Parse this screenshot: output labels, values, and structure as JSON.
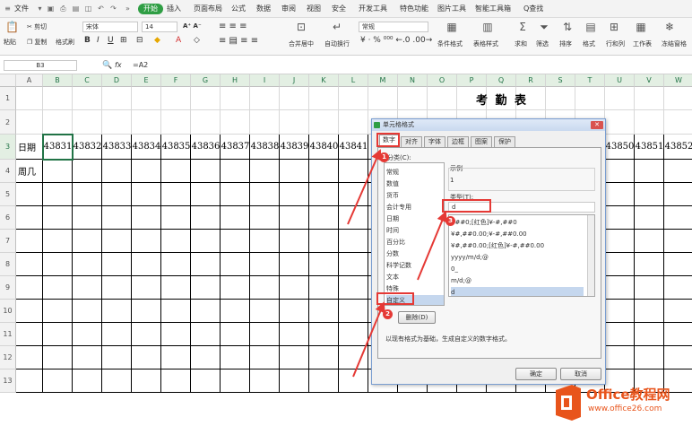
{
  "menu": {
    "file": "文件",
    "tabs": [
      "开始",
      "插入",
      "页面布局",
      "公式",
      "数据",
      "审阅",
      "视图",
      "安全",
      "开发工具",
      "特色功能",
      "图片工具",
      "智能工具箱"
    ],
    "search": "Q查找"
  },
  "ribbon": {
    "paste": "粘贴",
    "cut": "剪切",
    "copy": "复制",
    "format_painter": "格式刷",
    "font_name": "宋体",
    "font_size": "14",
    "merge_center": "合并居中",
    "wrap_text": "自动换行",
    "number_format": "常规",
    "conditional_format": "条件格式",
    "table_style": "表格样式",
    "sum": "求和",
    "filter": "筛选",
    "sort": "排序",
    "format": "格式",
    "rows_cols": "行和列",
    "worksheet": "工作表",
    "freeze": "冻结窗格"
  },
  "formula_bar": {
    "name_box": "B3",
    "fx": "fx",
    "formula": "=A2"
  },
  "columns": [
    "A",
    "B",
    "C",
    "D",
    "E",
    "F",
    "G",
    "H",
    "I",
    "J",
    "K",
    "L",
    "M",
    "N",
    "O",
    "P",
    "Q",
    "R",
    "S",
    "T",
    "U",
    "V",
    "W"
  ],
  "rows": [
    "1",
    "2",
    "3",
    "4",
    "5",
    "6",
    "7",
    "8",
    "9",
    "10",
    "11",
    "12",
    "13"
  ],
  "sheet": {
    "title": "考  勤  表",
    "row3_label": "日期",
    "row4_label": "周几",
    "dates_left": [
      "43831",
      "43832",
      "43833",
      "43834",
      "43835",
      "43836",
      "43837",
      "43838",
      "43839",
      "43840",
      "43841"
    ],
    "dates_right": [
      "43850",
      "43851",
      "43852"
    ]
  },
  "dialog": {
    "title": "单元格格式",
    "tabs": [
      "数字",
      "对齐",
      "字体",
      "边框",
      "图案",
      "保护"
    ],
    "category_label": "分类(C):",
    "categories": [
      "常规",
      "数值",
      "货币",
      "会计专用",
      "日期",
      "时间",
      "百分比",
      "分数",
      "科学记数",
      "文本",
      "特殊",
      "自定义"
    ],
    "sample_label": "示例",
    "sample_value": "1",
    "type_label": "类型(T):",
    "type_value": "d",
    "formats": [
      "¥##0;[红色]¥-#,##0",
      "¥#,##0.00;¥-#,##0.00",
      "¥#,##0.00;[红色]¥-#,##0.00",
      "yyyy/m/d;@",
      "0_",
      "m/d;@",
      "d"
    ],
    "delete_button": "删除(D)",
    "description": "以现有格式为基础，生成自定义的数字格式。",
    "ok_button": "确定",
    "cancel_button": "取消",
    "markers": [
      "1",
      "2",
      "3"
    ]
  },
  "watermark": {
    "brand": "Office教程网",
    "url": "www.office26.com"
  },
  "colors": {
    "accent_green": "#2f9e44",
    "selection_green": "#217346",
    "annotation_red": "#e53935",
    "brand_orange": "#e8541b"
  }
}
